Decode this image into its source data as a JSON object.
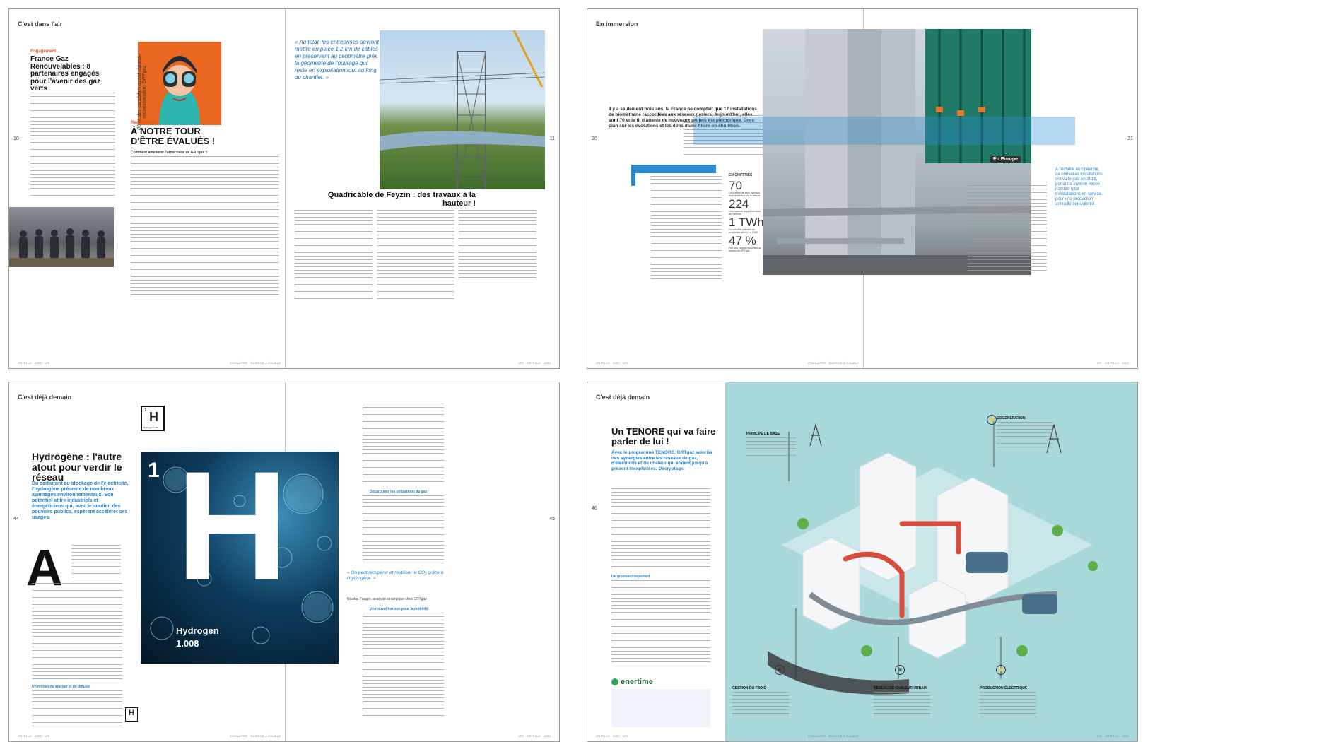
{
  "spread1": {
    "section": "C'est dans l'air",
    "page_left": "10",
    "page_right": "11",
    "footer_left": "GRTFLUX · 2022 · Nº2",
    "footer_center": "CONNAÎTRE · ÉNERGIE À DOUBLE",
    "footer_right": "Nº2 · GRTFLUX · 2022",
    "kicker1": "Engagement",
    "title1": "France Gaz Renouvelables : 8 partenaires engagés pour l'avenir des gaz verts",
    "kicker2": "Recrutement",
    "title2": "À NOTRE TOUR D'ÊTRE ÉVALUÉS !",
    "question": "Comment améliorer l'attractivité de GRTgaz ?",
    "vertical_stat": "85 % des candidats ayant répondu recommandent GRTgaz",
    "quote": "« Au total, les entreprises devront mettre en place 1,2 km de câbles en préservant au centimètre près la géométrie de l'ouvrage qui reste en exploitation tout au long du chantier. »",
    "title3": "Quadricâble de Feyzin : des travaux à la hauteur !",
    "photo_caption": "Crédits photo : GRTgaz"
  },
  "spread2": {
    "section": "En immersion",
    "page_left": "20",
    "page_right": "21",
    "footer_left": "GRTFLUX · 2022 · Nº2",
    "footer_center": "CONNAÎTRE · ÉNERGIE À DOUBLE",
    "footer_right": "Nº2 · GRTFLUX · 2022",
    "intro": "Il y a seulement trois ans, la France ne comptait que 17 installations de biométhane raccordées aux réseaux gaziers. Aujourd'hui, elles sont 70 et le fil d'attente de nouveaux projets est pléthorique. Gros plan sur les évolutions et les défis d'une filière en ébullition.",
    "figures_label": "EN CHIFFRES",
    "stats": [
      {
        "value": "70",
        "text": "Le nombre de sites injectant du biométhane sur le réseau."
      },
      {
        "value": "224",
        "text": "Une capacité supplémentaire de GWh/an."
      },
      {
        "value": "1 TWh",
        "text": "Ce serait le potentiel de production atteint en 2018."
      },
      {
        "value": "47 %",
        "text": "Part des projets raccordés au réseau de GRTgaz."
      }
    ],
    "europe_label": "En Europe",
    "europe_text": "À l'échelle européenne, de nouvelles installations ont vu le jour en 2019, portant à environ 460 le nombre total d'installations en service, pour une production annuelle équivalente."
  },
  "spread3": {
    "section": "C'est déjà demain",
    "page_left": "44",
    "page_right": "45",
    "footer_left": "GRTFLUX · 2022 · Nº2",
    "footer_center": "CONNAÎTRE · ÉNERGIE À DOUBLE",
    "footer_right": "Nº2 · GRTFLUX · 2022",
    "title": "Hydrogène : l'autre atout pour verdir le réseau",
    "subtitle": "Du carburant au stockage de l'électricité, l'hydrogène présente de nombreux avantages environnementaux. Son potentiel attire industriels et énergéticiens qui, avec le soutien des pouvoirs publics, espèrent accélérer ses usages.",
    "dropcap": "A",
    "element_number": "1",
    "element_symbol": "H",
    "element_name": "Hydrogen",
    "element_mass": "1.008",
    "small_element_name": "Hydrogen 1.008",
    "quote": "« On peut récupérer et réutiliser le CO₂ grâce à l'hydrogène. »",
    "quote_author": "Nicolas Fauger, analyste stratégique chez GRTgaz",
    "subhead1": "Décarboner les utilisations du gaz",
    "subhead2": "Un moyen de stocker et de diffuser",
    "subhead3": "Un nouvel horizon pour la mobilité"
  },
  "spread4": {
    "section": "C'est déjà demain",
    "page_left": "46",
    "page_right": "47",
    "footer_left": "GRTFLUX · 2022 · Nº2",
    "footer_center": "CONNAÎTRE · ÉNERGIE À DOUBLE",
    "footer_right": "Nº2 · GRTFLUX · 2022",
    "title": "Un TENORE qui va faire parler de lui !",
    "subtitle": "Avec le programme TENORE, GRTgaz valorise des synergies entre les réseaux de gaz, d'électricité et de chaleur qui étaient jusqu'à présent inexploitées. Décryptage.",
    "subhead": "Un gisement important",
    "logo": "enertime",
    "labels": [
      "PRINCIPE DE BASE",
      "COGÉNÉRATION",
      "GESTION DU FROID",
      "RÉSEAU DE CHALEUR URBAIN",
      "PRODUCTION ÉLECTRIQUE"
    ]
  }
}
